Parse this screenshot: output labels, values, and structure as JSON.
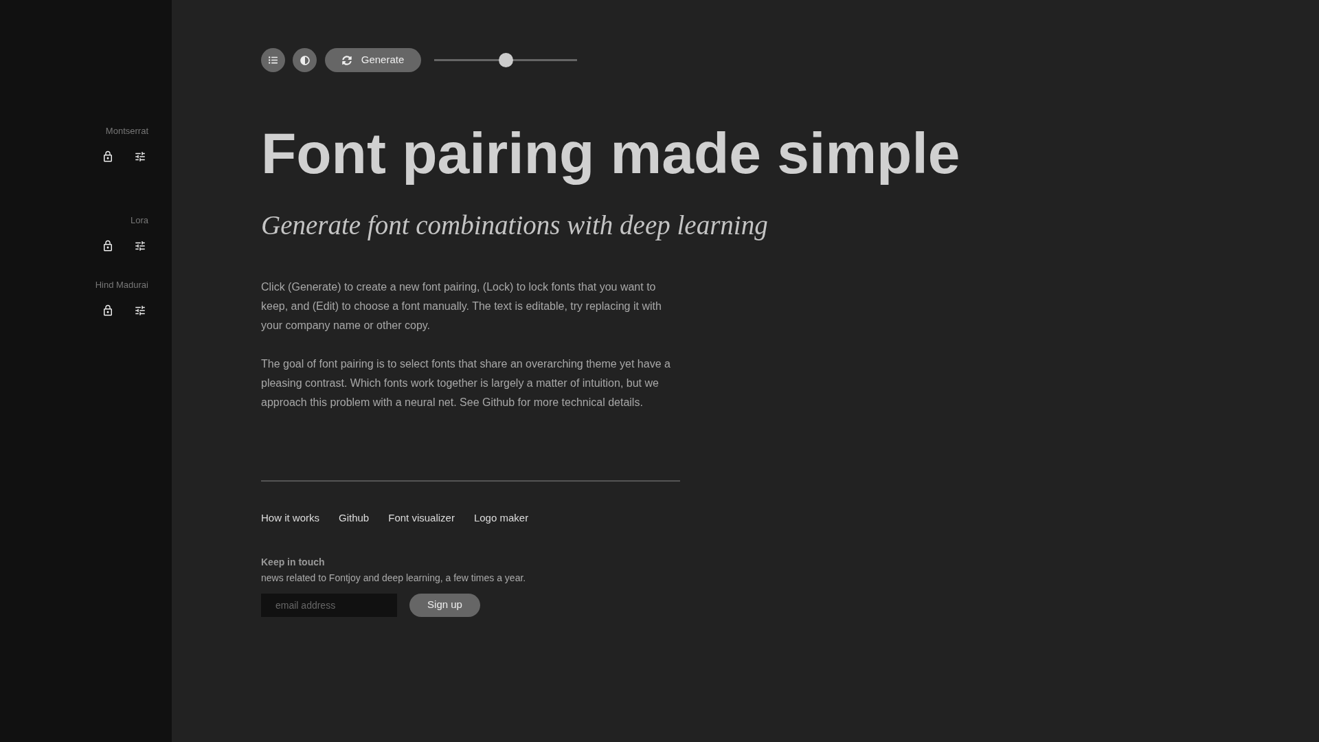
{
  "sidebar": {
    "fonts": [
      {
        "name": "Montserrat"
      },
      {
        "name": "Lora"
      },
      {
        "name": "Hind Madurai"
      }
    ]
  },
  "toolbar": {
    "generate_label": "Generate",
    "slider": {
      "level": 0.5
    }
  },
  "heading": "Font pairing made simple",
  "subtitle": "Generate font combinations with deep learning",
  "paragraphs": [
    "Click (Generate) to create a new font pairing, (Lock) to lock fonts that you want to keep, and (Edit) to choose a font manually. The text is editable, try replacing it with your company name or other copy.",
    "The goal of font pairing is to select fonts that share an overarching theme yet have a pleasing contrast. Which fonts work together is largely a matter of intuition, but we approach this problem with a neural net. See Github for more technical details."
  ],
  "footer": {
    "links": [
      "How it works",
      "Github",
      "Font visualizer",
      "Logo maker"
    ],
    "newsletter": {
      "title": "Keep in touch",
      "text": "news related to Fontjoy and deep learning, a few times a year.",
      "email": {
        "placeholder": "email address"
      },
      "button": "Sign up"
    }
  }
}
